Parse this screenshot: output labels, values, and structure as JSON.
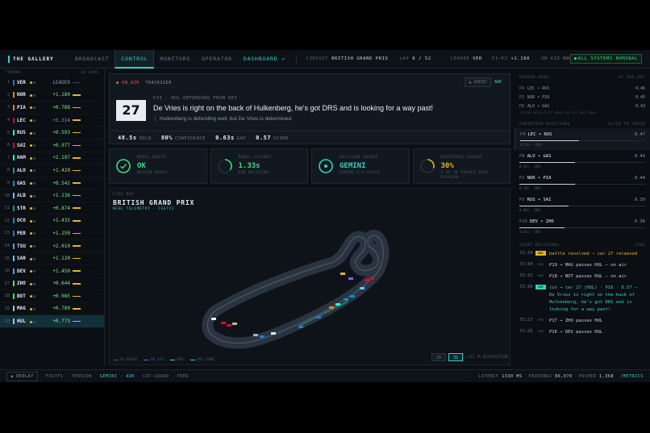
{
  "app": {
    "brand": "THE GALLERY",
    "tabs": [
      {
        "label": "BROADCAST"
      },
      {
        "label": "CONTROL"
      },
      {
        "label": "MONITORS"
      },
      {
        "label": "OPERATOR"
      },
      {
        "label": "DASHBOARD ↗"
      }
    ],
    "circuit_label": "CIRCUIT",
    "circuit": "BRITISH GRAND PRIX",
    "lap_label": "LAP",
    "lap": "8 / 52",
    "leader_label": "LEADER",
    "leader": "VER",
    "gap_label": "P1–P2",
    "gap": "+1.180",
    "onair_label": "ON AIR",
    "onair": "HUL",
    "status": "ALL SYSTEMS NOMINAL"
  },
  "timing": {
    "title": "TIMING",
    "count": "20 CARS",
    "rows": [
      {
        "pos": "1",
        "code": "VER",
        "color": "#3671c6",
        "tyre": "#e6b422",
        "gap": "LEADER",
        "kind": "lead"
      },
      {
        "pos": "2",
        "code": "NOR",
        "color": "#ff8000",
        "tyre": "#e6b422",
        "gap": "+1.180",
        "kind": "pos"
      },
      {
        "pos": "3",
        "code": "PIA",
        "color": "#ff8000",
        "tyre": "#e6b422",
        "gap": "+0.788",
        "kind": "pos"
      },
      {
        "pos": "4",
        "code": "LEC",
        "color": "#e8002d",
        "tyre": "#e6b422",
        "gap": "+3.314",
        "kind": "neg"
      },
      {
        "pos": "5",
        "code": "RUS",
        "color": "#27f4d2",
        "tyre": "#e6b422",
        "gap": "+0.593",
        "kind": "pos"
      },
      {
        "pos": "6",
        "code": "SAI",
        "color": "#e8002d",
        "tyre": "#e6b422",
        "gap": "+0.977",
        "kind": "pos"
      },
      {
        "pos": "7",
        "code": "HAM",
        "color": "#27f4d2",
        "tyre": "#e6b422",
        "gap": "+2.197",
        "kind": "pos"
      },
      {
        "pos": "8",
        "code": "ALO",
        "color": "#229971",
        "tyre": "#e6b422",
        "gap": "+1.420",
        "kind": "pos"
      },
      {
        "pos": "9",
        "code": "GAS",
        "color": "#0093cc",
        "tyre": "#e6b422",
        "gap": "+0.541",
        "kind": "pos"
      },
      {
        "pos": "10",
        "code": "ALB",
        "color": "#64c4ff",
        "tyre": "#e6b422",
        "gap": "+1.136",
        "kind": "pos"
      },
      {
        "pos": "11",
        "code": "STR",
        "color": "#229971",
        "tyre": "#e6b422",
        "gap": "+0.874",
        "kind": "pos"
      },
      {
        "pos": "12",
        "code": "OCO",
        "color": "#0093cc",
        "tyre": "#e6b422",
        "gap": "+1.435",
        "kind": "pos"
      },
      {
        "pos": "13",
        "code": "PER",
        "color": "#3671c6",
        "tyre": "#e6b422",
        "gap": "+1.150",
        "kind": "pos"
      },
      {
        "pos": "14",
        "code": "TSU",
        "color": "#6692ff",
        "tyre": "#e6b422",
        "gap": "+2.010",
        "kind": "pos"
      },
      {
        "pos": "15",
        "code": "SAR",
        "color": "#64c4ff",
        "tyre": "#e6b422",
        "gap": "+1.120",
        "kind": "pos"
      },
      {
        "pos": "16",
        "code": "DEV",
        "color": "#6692ff",
        "tyre": "#e6b422",
        "gap": "+1.450",
        "kind": "pos"
      },
      {
        "pos": "17",
        "code": "ZHO",
        "color": "#52e252",
        "tyre": "#e6b422",
        "gap": "+0.644",
        "kind": "pos"
      },
      {
        "pos": "18",
        "code": "BOT",
        "color": "#52e252",
        "tyre": "#e6b422",
        "gap": "+0.985",
        "kind": "pos"
      },
      {
        "pos": "19",
        "code": "MAG",
        "color": "#b6babd",
        "tyre": "#e6b422",
        "gap": "+0.789",
        "kind": "pos"
      },
      {
        "pos": "20",
        "code": "HUL",
        "color": "#b6babd",
        "tyre": "#e6b422",
        "gap": "+0.773",
        "kind": "pos",
        "selected": true
      }
    ]
  },
  "radio": {
    "onair": "● ON AIR",
    "trackside": "TRACKSIDE",
    "audio": "AUDIO",
    "adk": "ADK",
    "position": "27",
    "meta": "P16 · HUL DEFENDING FROM DEV",
    "text": "De Vries is right on the back of Hulkenberg, he's got DRS and is looking for a way past!",
    "sub": "Hulkenberg is defending well, but De Vries is determined.",
    "stats": [
      {
        "value": "48.5s",
        "label": "HOLD"
      },
      {
        "value": "80%",
        "label": "CONFIDENCE"
      },
      {
        "value": "0.63s",
        "label": "GAP"
      },
      {
        "value": "0.57",
        "label": "SCORE"
      }
    ]
  },
  "metrics": [
    {
      "label": "MODEL QUOTA",
      "value": "OK",
      "sub": "WITHIN QUOTA",
      "color": "#3ddc84",
      "ring": 1.0,
      "icon": "check-icon"
    },
    {
      "label": "MODEL LATENCY",
      "value": "1.33s",
      "sub": "PER DECISION",
      "color": "#3ddc84",
      "ring": 0.35,
      "icon": "latency-ring-icon"
    },
    {
      "label": "DECISION SOURCE",
      "value": "GEMINI",
      "sub": "GEMINI-2.5-FLASH",
      "color": "#2fd3c2",
      "ring": 1.0,
      "icon": "target-icon"
    },
    {
      "label": "OVERTAKES CAUGHT",
      "value": "30%",
      "sub": "3 OF 10 PASSES THIS SESSION",
      "color": "#e6b422",
      "ring": 0.3,
      "icon": "overtake-ring-icon"
    }
  ],
  "map": {
    "label": "LIVE MAP",
    "title": "BRITISH GRAND PRIX",
    "sub": "REAL TELEMETRY · FASTF1",
    "legend": [
      {
        "label": "IN RANGE",
        "color": "#4e5964"
      },
      {
        "label": "ON AIR",
        "color": "#8a5cf6"
      },
      {
        "label": "DRS",
        "color": "#3ddc84"
      },
      {
        "label": "DRS ZONE",
        "color": "#2fd3c2"
      }
    ],
    "view_2d": "2D",
    "view_3d": "3D",
    "elevation": "×11 M ELEVATION"
  },
  "passed_over": {
    "title": "PASSED OVER",
    "hint": "AT THE CUT",
    "rows": [
      {
        "pos": "P4",
        "label": "LEC • RUS",
        "score": "0.46"
      },
      {
        "pos": "P2",
        "label": "NOR • PIA",
        "score": "0.45"
      },
      {
        "pos": "P8",
        "label": "ALO • GAS",
        "score": "0.43"
      }
    ],
    "note": "scored below 0.57 when the cut was taken"
  },
  "contested": {
    "title": "CONTESTED POSITIONS",
    "hint": "CLICK TO TRACK",
    "rows": [
      {
        "pos": "P4",
        "label": "LEC • RUS",
        "score": "0.47",
        "sub": "0.59s · DRS",
        "fill": 0.47
      },
      {
        "pos": "P8",
        "label": "ALO • GAS",
        "score": "0.44",
        "sub": "0.54s · DRS",
        "fill": 0.44
      },
      {
        "pos": "P2",
        "label": "NOR • PIA",
        "score": "0.44",
        "sub": "0.79s · DRS",
        "fill": 0.44
      },
      {
        "pos": "P5",
        "label": "RUS • SAI",
        "score": "0.39",
        "sub": "0.98s · DRS",
        "fill": 0.39
      },
      {
        "pos": "P16",
        "label": "DEV • ZHO",
        "score": "0.36",
        "sub": "0.64s · DRS",
        "fill": 0.36
      }
    ]
  },
  "decisions": {
    "title": "AGENT DECISIONS",
    "hint": "LIVE",
    "rows": [
      {
        "time": "73:34",
        "tag": "REL",
        "tagkind": "rel",
        "msg": "battle resolved — car 27 released",
        "kind": "hi"
      },
      {
        "time": "73:34",
        "tag": "SYS",
        "tagkind": "sys",
        "msg": "P19 → MAG passes HUL — on air",
        "kind": ""
      },
      {
        "time": "73:31",
        "tag": "SYS",
        "tagkind": "sys",
        "msg": "P18 → BOT passes HUL — on air",
        "kind": ""
      },
      {
        "time": "73:30",
        "tag": "CUT",
        "tagkind": "cut",
        "msg": "cut → car 27 (HUL) · P16 · 0.57 — De Vries is right on the back of Hulkenberg, he's got DRS and is looking for a way past!",
        "kind": "cy"
      },
      {
        "time": "73:27",
        "tag": "SYS",
        "tagkind": "sys",
        "msg": "P17 → ZHO passes HUL",
        "kind": ""
      },
      {
        "time": "73:25",
        "tag": "SYS",
        "tagkind": "sys",
        "msg": "P16 → DEV passes HUL",
        "kind": ""
      }
    ]
  },
  "bottom": {
    "replay": "◀ REPLAY",
    "items": [
      "FASTF1",
      "TENSION",
      "GEMINI · ADK",
      "CUT-GUARD",
      "FEED"
    ],
    "latency_label": "LATENCY",
    "latency": "1330 MS",
    "pairings_label": "PAIRINGS",
    "pairings": "86,070",
    "pushed_label": "PUSHED",
    "pushed": "1,368",
    "metrics_link": "/METRICS"
  }
}
